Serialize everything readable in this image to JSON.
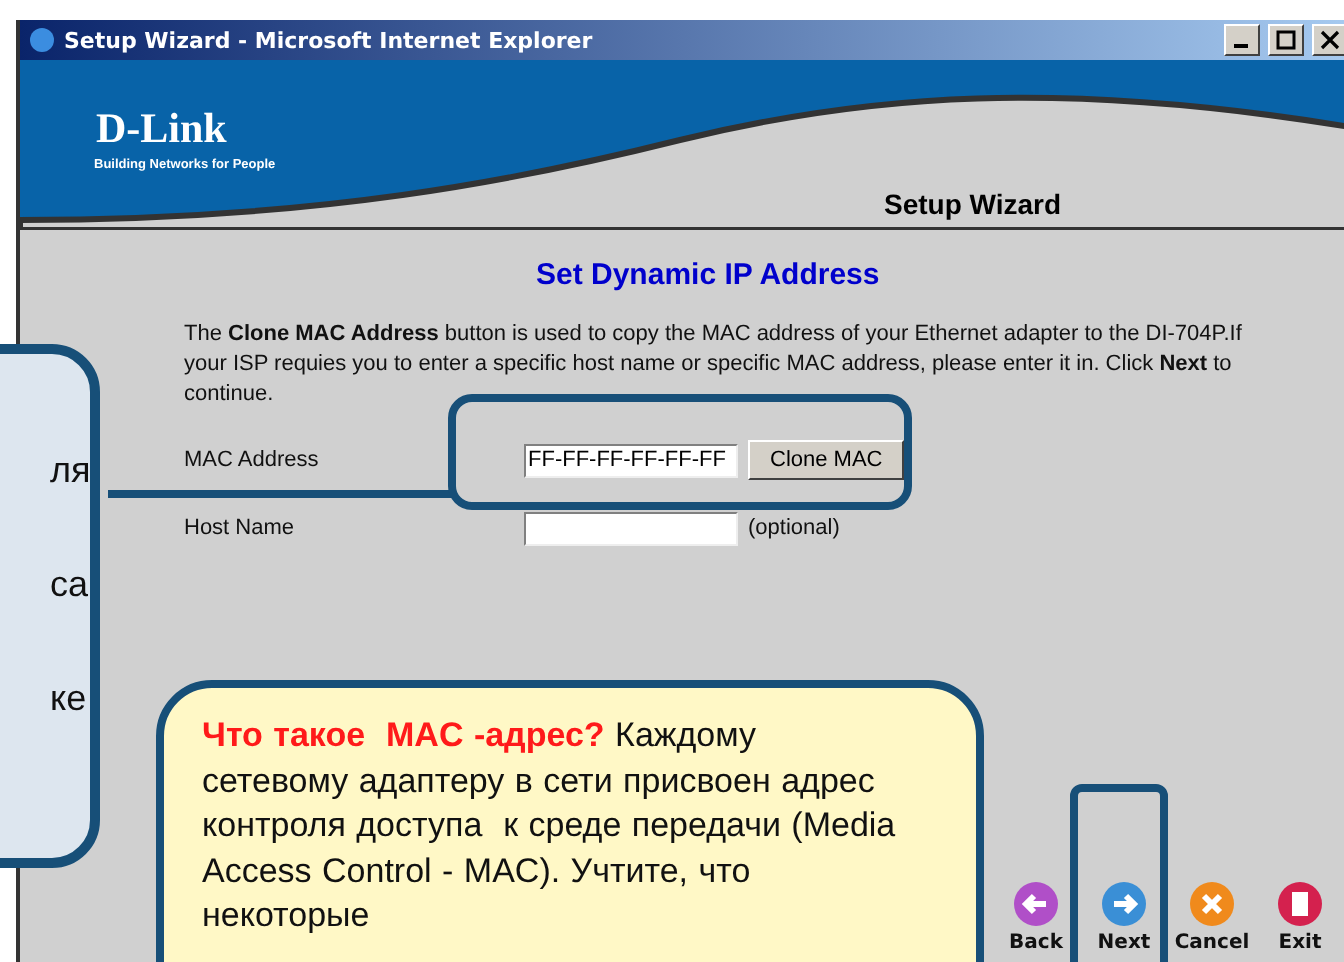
{
  "window": {
    "title": "Setup Wizard - Microsoft Internet Explorer"
  },
  "header": {
    "logo": "D-Link",
    "tagline": "Building Networks for People",
    "title": "Setup Wizard"
  },
  "page": {
    "heading": "Set Dynamic IP Address",
    "intro": "The **Clone MAC Address** button is used to copy the MAC address of your Ethernet adapter to the DI-704P.If your ISP requies you to enter a specific host name or specific MAC address, please enter it in. Click **Next** to continue.",
    "fields": [
      {
        "label": "MAC Address",
        "value": "FF-FF-FF-FF-FF-FF",
        "button": "Clone MAC"
      },
      {
        "label": "Host Name",
        "note": "(optional)"
      }
    ]
  },
  "nav": [
    {
      "kind": "back",
      "label": "Back"
    },
    {
      "kind": "next",
      "label": "Next"
    },
    {
      "kind": "cancel",
      "label": "Cancel"
    },
    {
      "kind": "exit",
      "label": "Exit"
    }
  ],
  "callouts": {
    "left_fragments": [
      "ля",
      "са",
      "ке"
    ],
    "note": "**Что такое  MAC -адрес?** Каждому сетевому адаптеру в сети присвоен адрес контроля доступа  к среде передачи (Media Access Control - MAC). Учтите, что некоторые"
  }
}
